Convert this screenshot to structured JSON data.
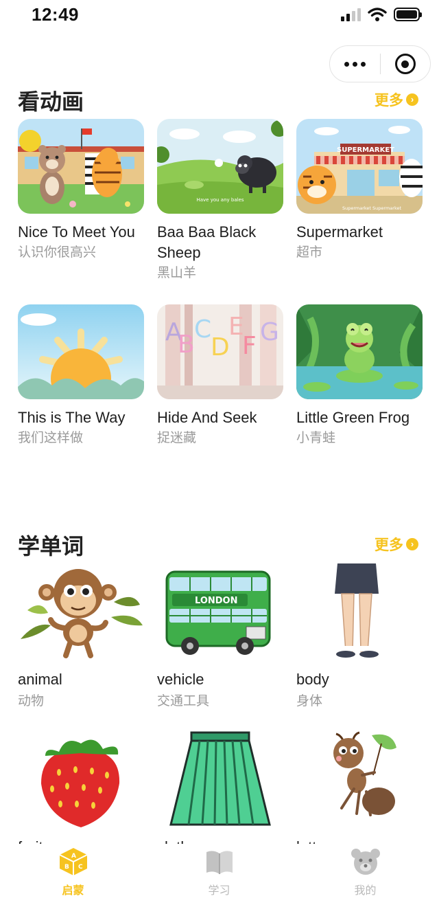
{
  "status": {
    "time": "12:49"
  },
  "capsule": {
    "more_icon": "more-dots-icon",
    "close_icon": "target-circle-icon"
  },
  "videos": {
    "title": "看动画",
    "more_label": "更多",
    "items": [
      {
        "title": "Nice To Meet You",
        "subtitle": "认识你很高兴"
      },
      {
        "title": "Baa Baa Black Sheep",
        "subtitle": "黑山羊",
        "caption": "Have you any bales"
      },
      {
        "title": "Supermarket",
        "subtitle": "超市",
        "sign": "SUPERMARKET",
        "caption": "Supermarket Supermarket"
      },
      {
        "title": "This is The Way",
        "subtitle": "我们这样做"
      },
      {
        "title": "Hide And Seek",
        "subtitle": "捉迷藏",
        "letters": "ABCDEFG"
      },
      {
        "title": "Little Green Frog",
        "subtitle": "小青蛙"
      }
    ]
  },
  "words": {
    "title": "学单词",
    "more_label": "更多",
    "items": [
      {
        "title": "animal",
        "subtitle": "动物"
      },
      {
        "title": "vehicle",
        "subtitle": "交通工具",
        "bus_sign": "LONDON"
      },
      {
        "title": "body",
        "subtitle": "身体"
      },
      {
        "title": "fruit",
        "subtitle": ""
      },
      {
        "title": "clothes",
        "subtitle": ""
      },
      {
        "title": "letter",
        "subtitle": ""
      }
    ]
  },
  "tabs": [
    {
      "label": "启蒙",
      "icon": "abc-cube-icon",
      "active": true
    },
    {
      "label": "学习",
      "icon": "book-icon",
      "active": false
    },
    {
      "label": "我的",
      "icon": "bear-icon",
      "active": false
    }
  ],
  "colors": {
    "accent": "#f6c31f",
    "muted": "#b9b9b9",
    "subtitle": "#9a9a9a"
  }
}
